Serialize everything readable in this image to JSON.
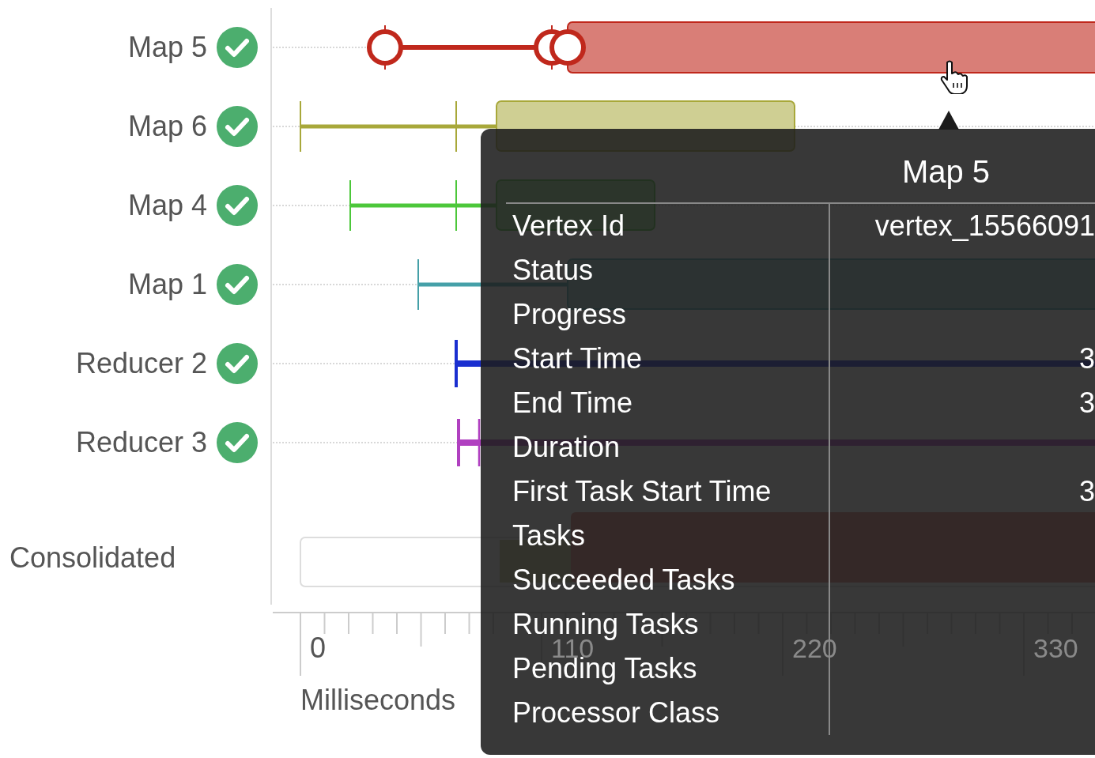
{
  "vertices": [
    {
      "name": "Map 5",
      "color": "#c0281c"
    },
    {
      "name": "Map 6",
      "color": "#a8a83a"
    },
    {
      "name": "Map 4",
      "color": "#4cc73a"
    },
    {
      "name": "Map 1",
      "color": "#45a0a8"
    },
    {
      "name": "Reducer 2",
      "color": "#1a2fd0"
    },
    {
      "name": "Reducer 3",
      "color": "#b040c0"
    }
  ],
  "consolidated": {
    "label": "Consolidated"
  },
  "axis": {
    "ticks": [
      "0",
      "110",
      "220",
      "330"
    ],
    "label": "Milliseconds"
  },
  "tooltip": {
    "title": "Map 5",
    "rows": [
      {
        "label": "Vertex Id",
        "value": "vertex_15566091"
      },
      {
        "label": "Status"
      },
      {
        "label": "Progress"
      },
      {
        "label": "Start Time",
        "value": "3"
      },
      {
        "label": "End Time",
        "value": "3"
      },
      {
        "label": "Duration"
      },
      {
        "label": "First Task Start Time",
        "value": "3"
      },
      {
        "label": "Tasks"
      },
      {
        "label": "Succeeded Tasks"
      },
      {
        "label": "Running Tasks"
      },
      {
        "label": "Pending Tasks"
      },
      {
        "label": "Processor Class"
      }
    ]
  }
}
